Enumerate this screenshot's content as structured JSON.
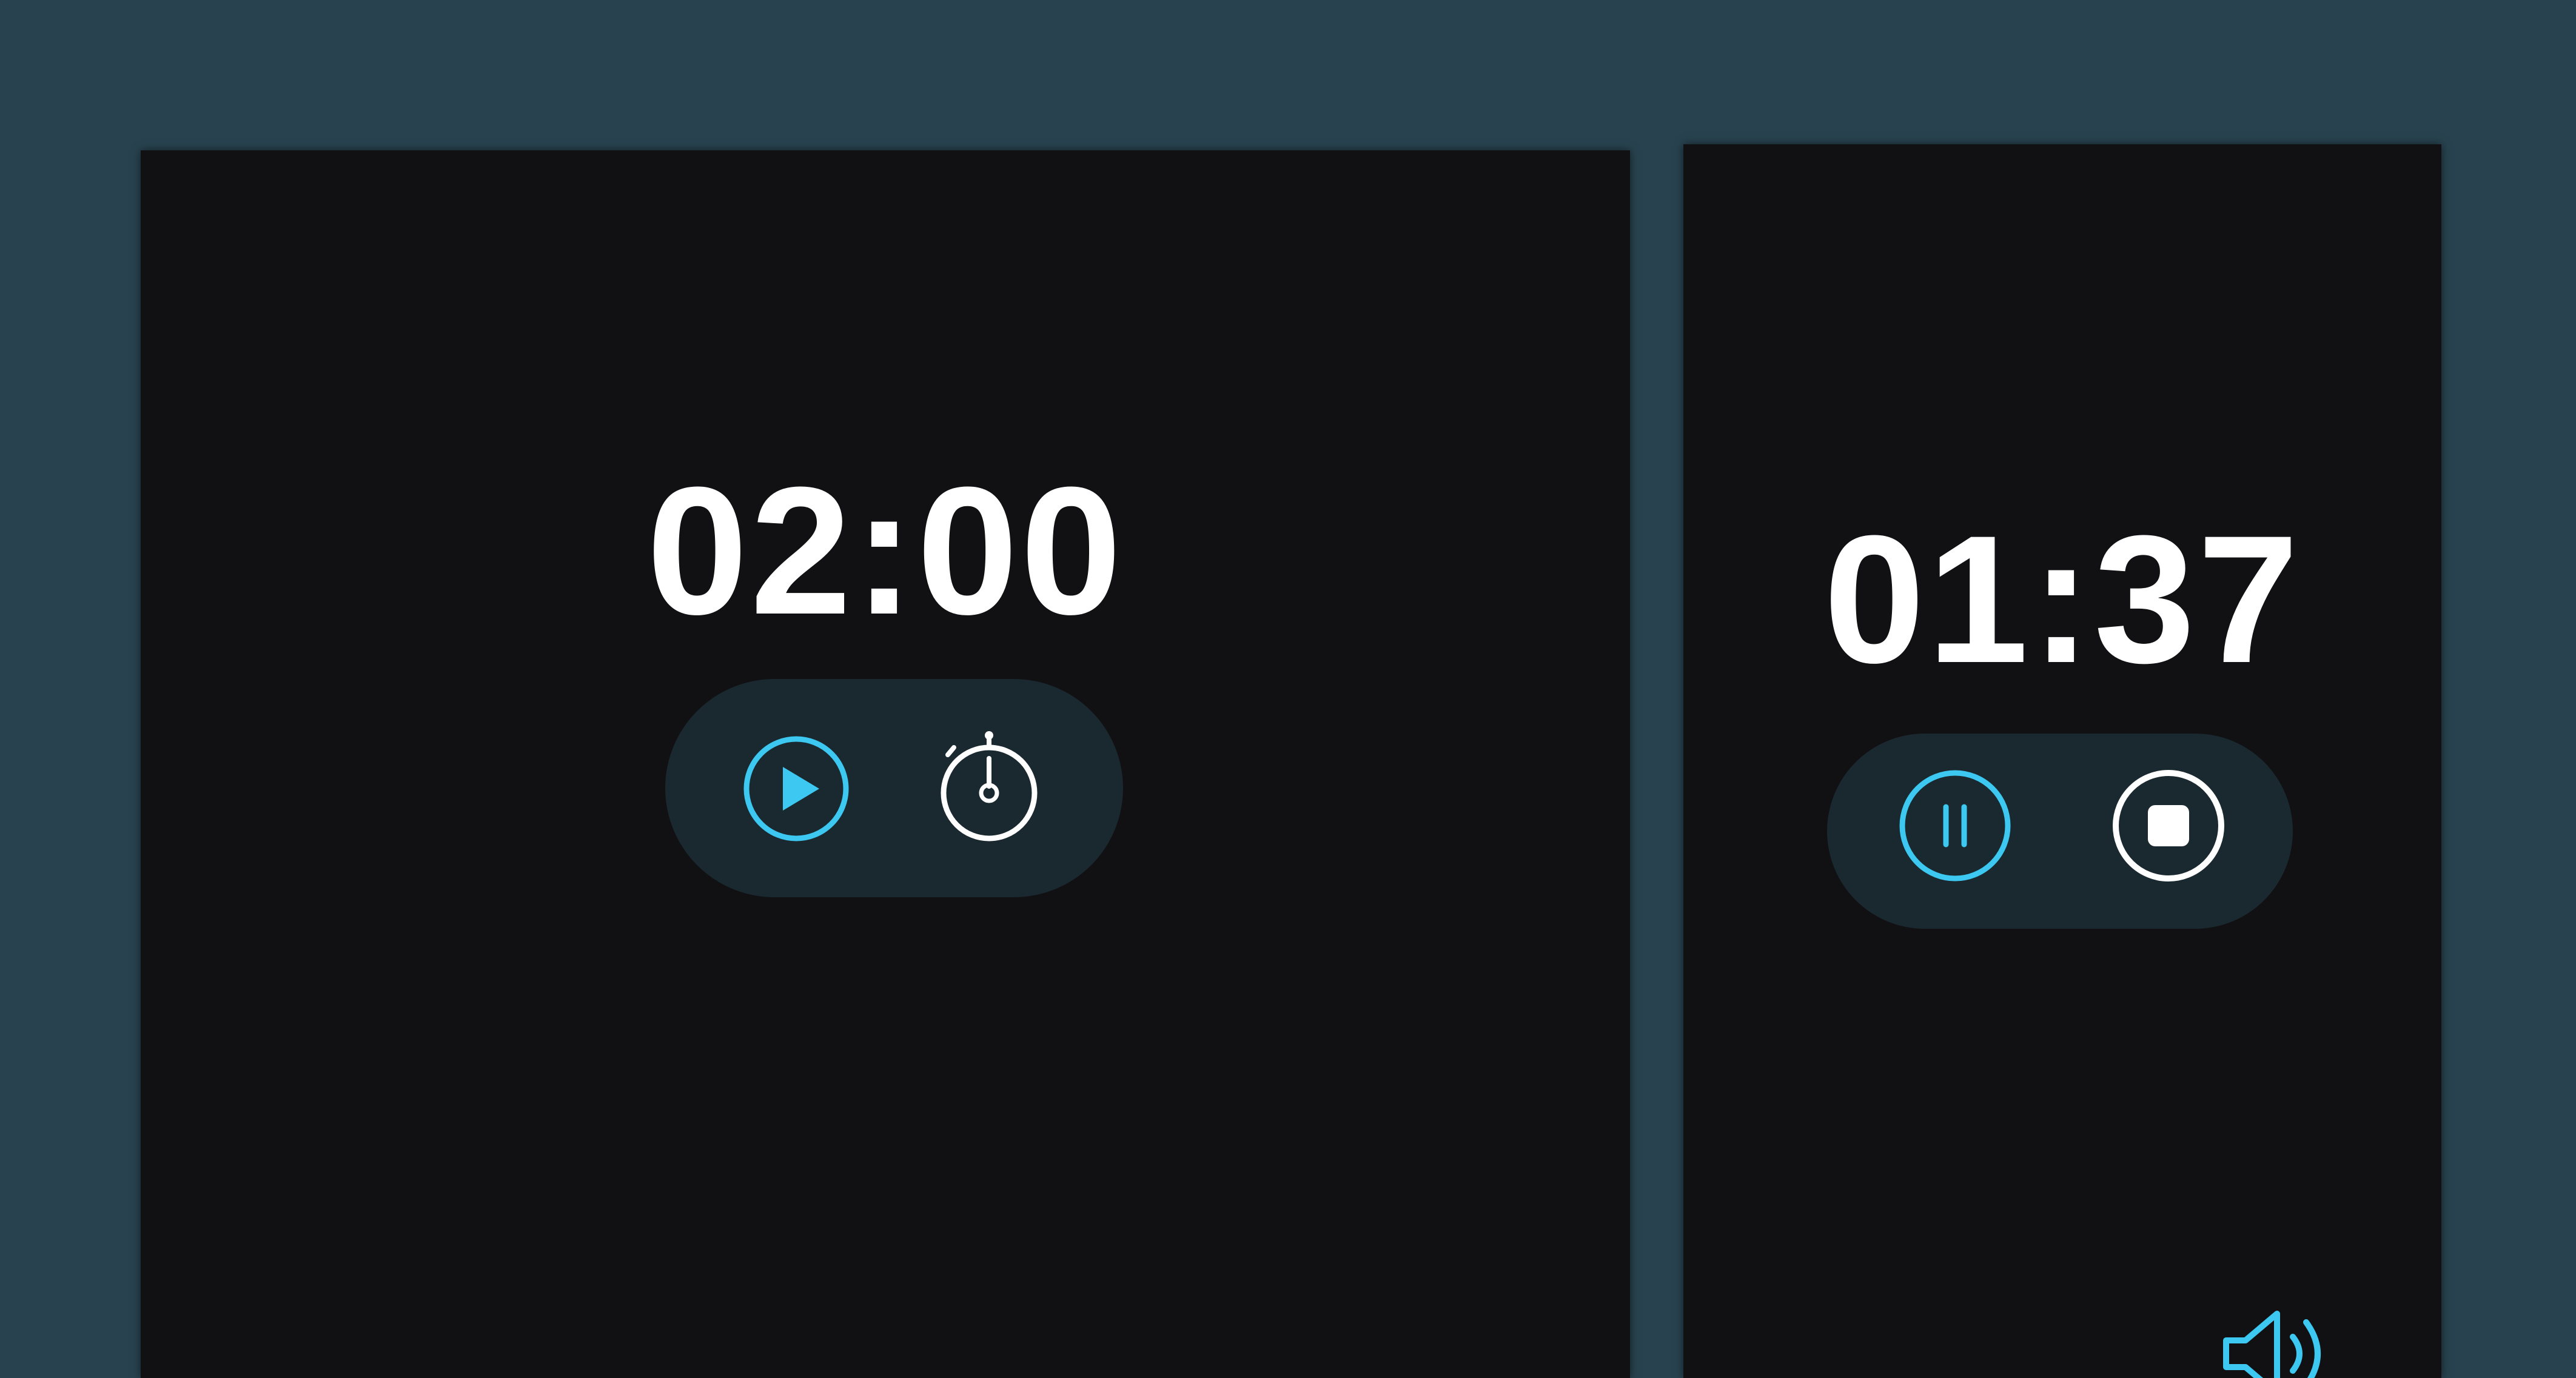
{
  "colors": {
    "background": "#28434f",
    "panel": "#111113",
    "controls_pill": "#1a2930",
    "accent": "#3cc8f0",
    "text": "#ffffff"
  },
  "timer_setup": {
    "time": "02:00",
    "controls": {
      "start_icon": "play-icon",
      "mode_icon": "stopwatch-icon"
    }
  },
  "timer_running": {
    "time": "01:37",
    "controls": {
      "pause_icon": "pause-icon",
      "stop_icon": "stop-icon"
    },
    "volume_icon": "volume-icon"
  }
}
